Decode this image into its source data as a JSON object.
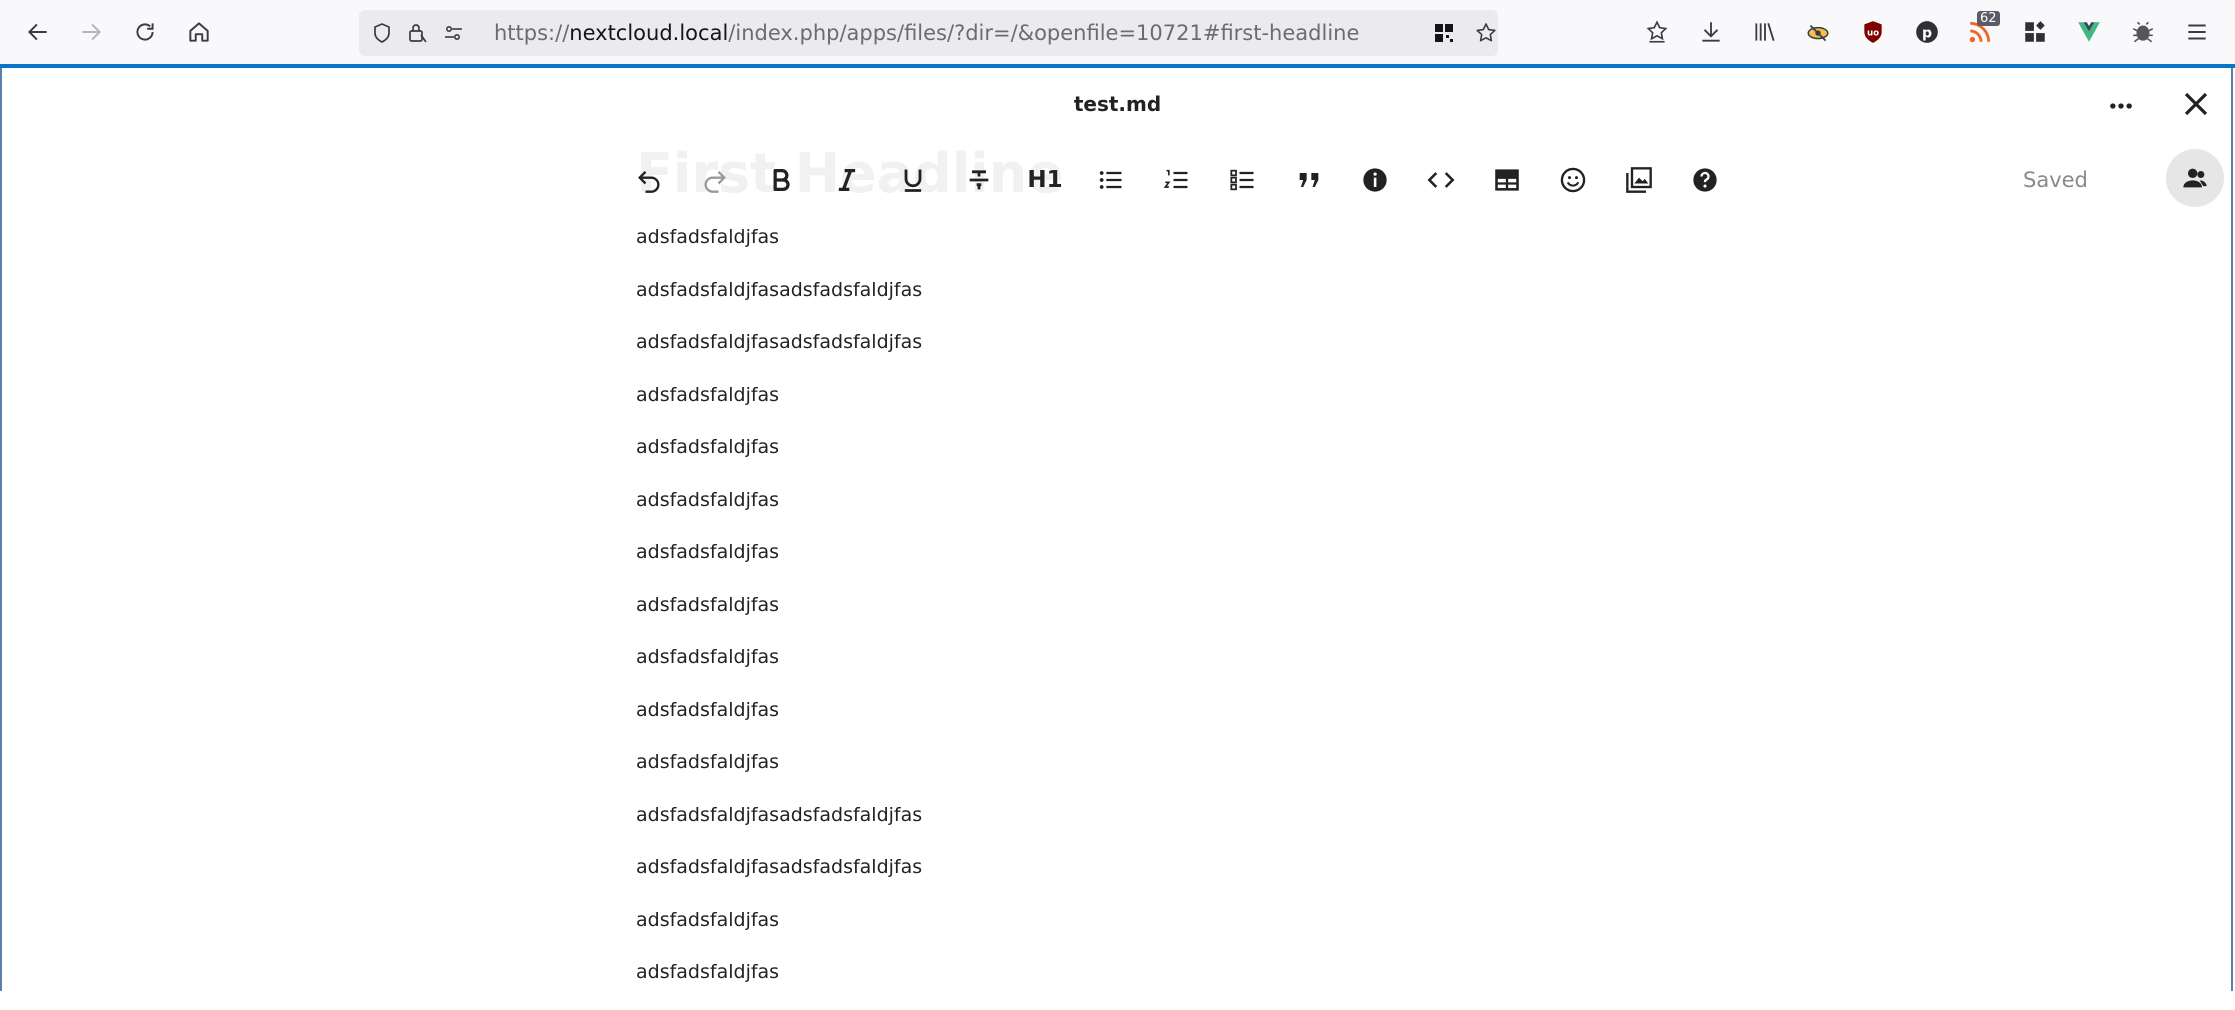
{
  "browser": {
    "url_prefix": "https://",
    "url_host": "nextcloud.local",
    "url_path": "/index.php/apps/files/?dir=/&openfile=10721#first-headline",
    "rss_badge_count": "62",
    "accent_color": "#0a74c8"
  },
  "viewer": {
    "file_title": "test.md",
    "saved_status": "Saved"
  },
  "editor": {
    "ghost_heading": "First Headline",
    "h1_label": "H1"
  },
  "document": {
    "lines": [
      "adsfadsfaldjfas",
      "adsfadsfaldjfasadsfadsfaldjfas",
      "adsfadsfaldjfasadsfadsfaldjfas",
      "adsfadsfaldjfas",
      "adsfadsfaldjfas",
      "adsfadsfaldjfas",
      "adsfadsfaldjfas",
      "adsfadsfaldjfas",
      "adsfadsfaldjfas",
      "adsfadsfaldjfas",
      "adsfadsfaldjfas",
      "adsfadsfaldjfasadsfadsfaldjfas",
      "adsfadsfaldjfasadsfadsfaldjfas",
      "adsfadsfaldjfas",
      "adsfadsfaldjfas"
    ]
  }
}
